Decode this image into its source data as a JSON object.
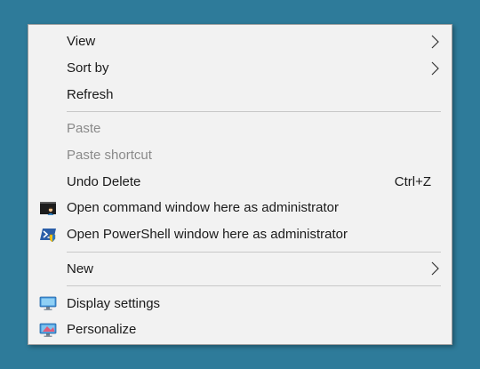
{
  "menu": {
    "items": [
      {
        "label": "View",
        "submenu": true,
        "disabled": false
      },
      {
        "label": "Sort by",
        "submenu": true,
        "disabled": false
      },
      {
        "label": "Refresh",
        "submenu": false,
        "disabled": false
      },
      {
        "label": "Paste",
        "submenu": false,
        "disabled": true
      },
      {
        "label": "Paste shortcut",
        "submenu": false,
        "disabled": true
      },
      {
        "label": "Undo Delete",
        "shortcut": "Ctrl+Z",
        "submenu": false,
        "disabled": false
      },
      {
        "label": "Open command window here as administrator",
        "icon": "command-prompt-icon",
        "submenu": false,
        "disabled": false
      },
      {
        "label": "Open PowerShell window here as administrator",
        "icon": "powershell-icon",
        "submenu": false,
        "disabled": false
      },
      {
        "label": "New",
        "submenu": true,
        "disabled": false
      },
      {
        "label": "Display settings",
        "icon": "display-settings-icon",
        "submenu": false,
        "disabled": false
      },
      {
        "label": "Personalize",
        "icon": "personalize-icon",
        "submenu": false,
        "disabled": false
      }
    ]
  },
  "colors": {
    "desktop_background": "#2e7b9a",
    "menu_background": "#f2f2f2",
    "disabled_text": "#8a8a8a"
  }
}
